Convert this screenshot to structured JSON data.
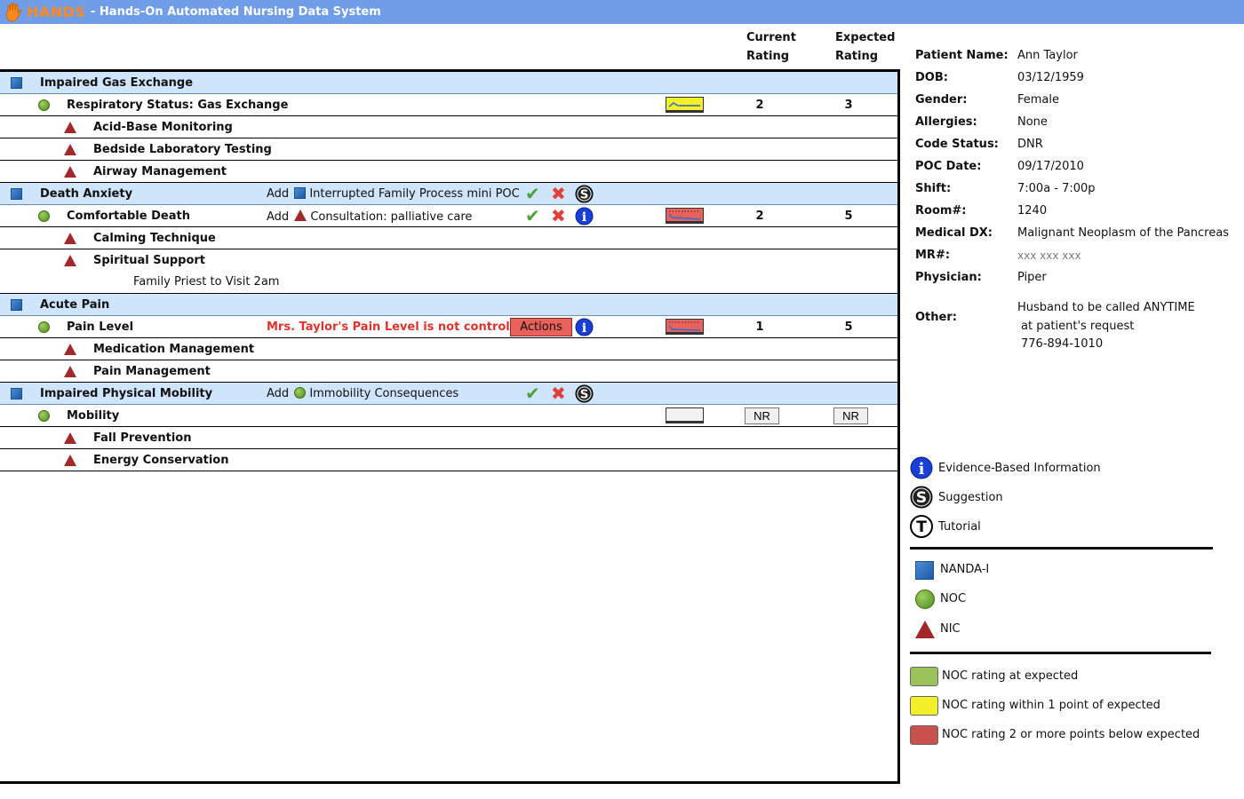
{
  "app": {
    "logo_text": "HANDS",
    "title": "- Hands-On Automated Nursing Data System"
  },
  "columns": {
    "current_line1": "Current",
    "current_line2": "Rating",
    "expected_line1": "Expected",
    "expected_line2": "Rating"
  },
  "poc": {
    "rows": [
      {
        "label": "Impaired Gas Exchange"
      },
      {
        "label": "Respiratory Status: Gas Exchange",
        "current": "2",
        "expected": "3",
        "trend": "yellow"
      },
      {
        "label": "Acid-Base Monitoring"
      },
      {
        "label": "Bedside Laboratory Testing"
      },
      {
        "label": "Airway Management"
      },
      {
        "label": "Death Anxiety",
        "add_prefix": "Add",
        "add_text": "Interrupted Family Process mini POC"
      },
      {
        "label": "Comfortable Death",
        "add_prefix": "Add",
        "add_text": "Consultation: palliative care",
        "current": "2",
        "expected": "5",
        "trend": "red"
      },
      {
        "label": "Calming Technique"
      },
      {
        "label": "Spiritual Support",
        "note": "Family Priest to Visit 2am"
      },
      {
        "label": "Acute Pain"
      },
      {
        "label": "Pain Level",
        "alert": "Mrs. Taylor's Pain Level is not controlled.",
        "button": "Actions",
        "current": "1",
        "expected": "5",
        "trend": "red"
      },
      {
        "label": "Medication Management"
      },
      {
        "label": "Pain Management"
      },
      {
        "label": "Impaired Physical Mobility",
        "add_prefix": "Add",
        "add_text": "Immobility Consequences"
      },
      {
        "label": "Mobility",
        "current": "NR",
        "expected": "NR",
        "trend": "empty"
      },
      {
        "label": "Fall Prevention"
      },
      {
        "label": "Energy Conservation"
      }
    ]
  },
  "patient": {
    "name_label": "Patient Name:",
    "name": "Ann Taylor",
    "dob_label": "DOB:",
    "dob": "03/12/1959",
    "gender_label": "Gender:",
    "gender": "Female",
    "allergies_label": "Allergies:",
    "allergies": "None",
    "code_label": "Code Status:",
    "code": "DNR",
    "poc_date_label": "POC Date:",
    "poc_date": "09/17/2010",
    "shift_label": "Shift:",
    "shift": "7:00a - 7:00p",
    "room_label": "Room#:",
    "room": "1240",
    "dx_label": "Medical DX:",
    "dx": "Malignant Neoplasm of the Pancreas",
    "mr_label": "MR#:",
    "mr": "xxx xxx xxx",
    "physician_label": "Physician:",
    "physician": "Piper",
    "other_label": "Other:",
    "other_line1": "Husband to be called ANYTIME",
    "other_line2": "at patient's request",
    "other_line3": "776-894-1010"
  },
  "legend": {
    "info": "Evidence-Based Information",
    "suggestion": "Suggestion",
    "tutorial": "Tutorial",
    "nanda": "NANDA-I",
    "noc": "NOC",
    "nic": "NIC",
    "green": "NOC rating at expected",
    "yellow": "NOC rating within 1 point of expected",
    "red": "NOC rating 2 or more points below expected",
    "colors": {
      "green": "#9bc15a",
      "yellow": "#f3ef2a",
      "red": "#c9504b",
      "nanda": "#1d5aa6",
      "noc": "#4f8a1d",
      "nic": "#a3282a"
    }
  }
}
